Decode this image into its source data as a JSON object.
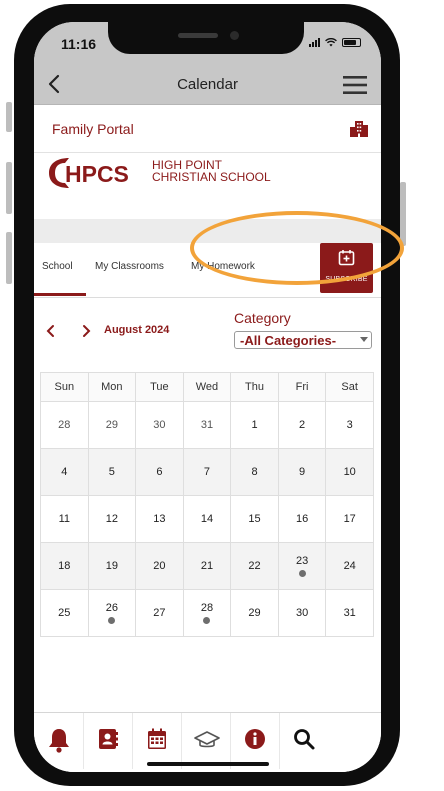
{
  "status_bar": {
    "time": "11:16"
  },
  "nav": {
    "title": "Calendar"
  },
  "portal": {
    "title": "Family Portal"
  },
  "logo": {
    "mark": "HPCS",
    "line1": "HIGH POINT",
    "line2": "CHRISTIAN SCHOOL"
  },
  "tabs": [
    {
      "label": "School",
      "active": true
    },
    {
      "label": "My Classrooms",
      "active": false
    },
    {
      "label": "My Homework",
      "active": false
    }
  ],
  "subscribe": {
    "label": "SUBSCRIBE"
  },
  "month": {
    "label": "August 2024"
  },
  "category": {
    "label": "Category",
    "selected": "-All Categories-"
  },
  "calendar": {
    "weekdays": [
      "Sun",
      "Mon",
      "Tue",
      "Wed",
      "Thu",
      "Fri",
      "Sat"
    ],
    "weeks": [
      [
        "28",
        "29",
        "30",
        "31",
        "1",
        "2",
        "3"
      ],
      [
        "4",
        "5",
        "6",
        "7",
        "8",
        "9",
        "10"
      ],
      [
        "11",
        "12",
        "13",
        "14",
        "15",
        "16",
        "17"
      ],
      [
        "18",
        "19",
        "20",
        "21",
        "22",
        "23",
        "24"
      ],
      [
        "25",
        "26",
        "27",
        "28",
        "29",
        "30",
        "31"
      ]
    ],
    "event_days": [
      "23",
      "26",
      "28"
    ]
  },
  "bottom_nav": [
    {
      "icon": "bell-icon"
    },
    {
      "icon": "contacts-icon"
    },
    {
      "icon": "calendar-icon"
    },
    {
      "icon": "graduation-cap-icon"
    },
    {
      "icon": "info-icon"
    },
    {
      "icon": "search-icon"
    }
  ],
  "colors": {
    "brand": "#8b1a1a",
    "highlight": "#f2a33a",
    "chrome": "#c7c7c7"
  }
}
